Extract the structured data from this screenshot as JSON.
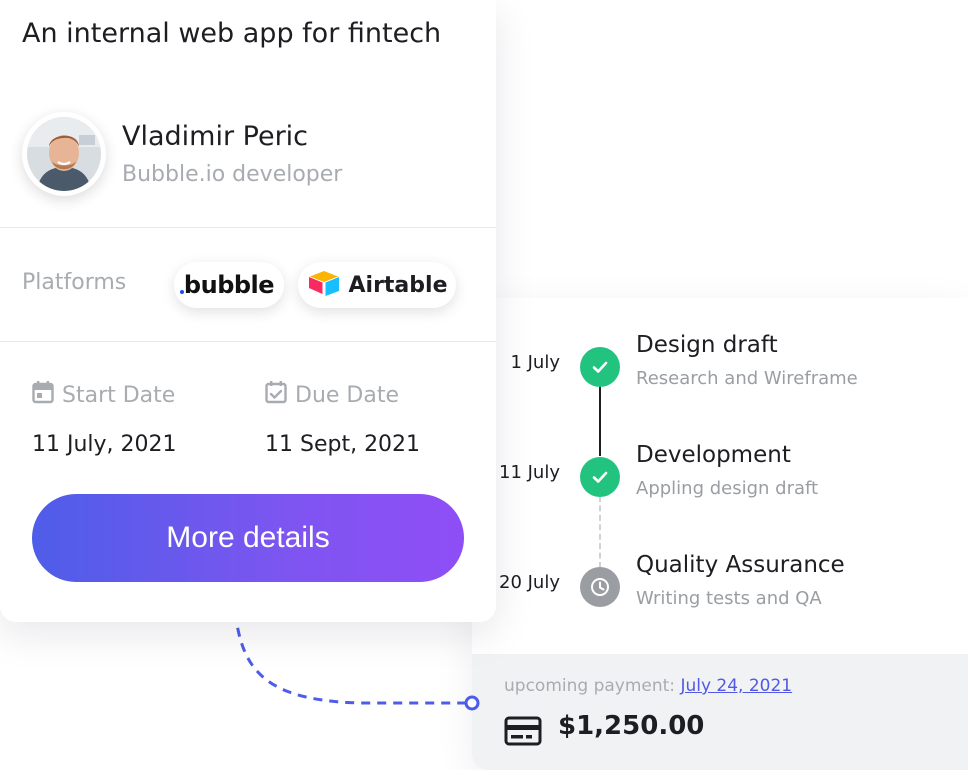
{
  "project": {
    "title": "An internal web app for fintech",
    "person": {
      "name": "Vladimir Peric",
      "role": "Bubble.io developer"
    },
    "platforms_label": "Platforms",
    "platforms": [
      {
        "name": "bubble",
        "icon": "bubble-logo"
      },
      {
        "name": "Airtable",
        "icon": "airtable-logo"
      }
    ],
    "start_date": {
      "label": "Start Date",
      "value": "11 July, 2021",
      "icon": "calendar-icon"
    },
    "due_date": {
      "label": "Due Date",
      "value": "11 Sept, 2021",
      "icon": "calendar-check-icon"
    },
    "button_label": "More details"
  },
  "timeline": {
    "steps": [
      {
        "date": "1 July",
        "title": "Design draft",
        "subtitle": "Research and Wireframe",
        "status": "done",
        "icon": "check-icon"
      },
      {
        "date": "11 July",
        "title": "Development",
        "subtitle": "Appling design draft",
        "status": "done",
        "icon": "check-icon"
      },
      {
        "date": "20 July",
        "title": "Quality Assurance",
        "subtitle": "Writing tests and QA",
        "status": "pending",
        "icon": "clock-icon"
      }
    ],
    "payment": {
      "label": "upcoming payment:",
      "date": "July 24, 2021",
      "amount": "$1,250.00",
      "icon": "credit-card-icon"
    }
  },
  "colors": {
    "accent_start": "#4e5de8",
    "accent_end": "#8f4ef6",
    "done": "#22c37f",
    "pending": "#9a9da2",
    "link": "#5159e6"
  }
}
